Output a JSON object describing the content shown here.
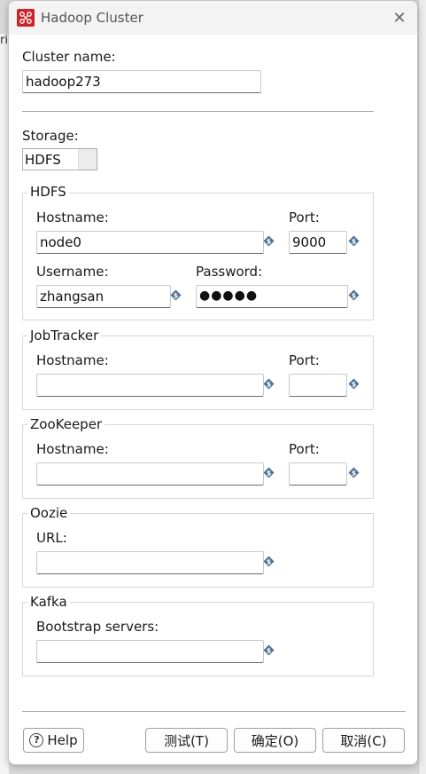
{
  "window": {
    "title": "Hadoop Cluster",
    "close_glyph": "✕"
  },
  "background": {
    "left_glyph": "ri"
  },
  "cluster": {
    "label": "Cluster name:",
    "value": "hadoop273"
  },
  "storage": {
    "label": "Storage:",
    "value": "HDFS"
  },
  "hdfs": {
    "title": "HDFS",
    "hostname_label": "Hostname:",
    "hostname_value": "node0",
    "port_label": "Port:",
    "port_value": "9000",
    "username_label": "Username:",
    "username_value": "zhangsan",
    "password_label": "Password:",
    "password_value": "●●●●●"
  },
  "jobtracker": {
    "title": "JobTracker",
    "hostname_label": "Hostname:",
    "hostname_value": "",
    "port_label": "Port:",
    "port_value": ""
  },
  "zookeeper": {
    "title": "ZooKeeper",
    "hostname_label": "Hostname:",
    "hostname_value": "",
    "port_label": "Port:",
    "port_value": ""
  },
  "oozie": {
    "title": "Oozie",
    "url_label": "URL:",
    "url_value": ""
  },
  "kafka": {
    "title": "Kafka",
    "servers_label": "Bootstrap servers:",
    "servers_value": ""
  },
  "buttons": {
    "help": "Help",
    "help_glyph": "?",
    "test": "测试(T)",
    "ok": "确定(O)",
    "cancel": "取消(C)"
  },
  "icons": {
    "app": "hadoop-cluster-icon",
    "variable": "variable-diamond-icon",
    "close": "close-icon",
    "help": "help-icon"
  },
  "colors": {
    "app_icon": "#c8262b",
    "variable_icon": "#4a6f8f",
    "dialog_bg": "#ffffff"
  }
}
